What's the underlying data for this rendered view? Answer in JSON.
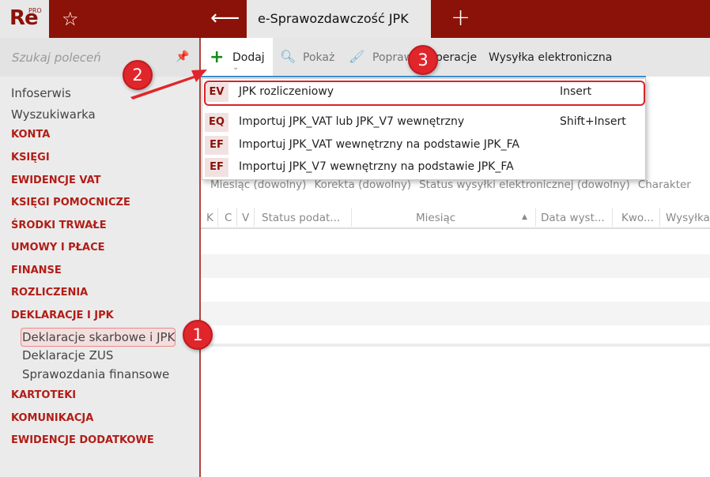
{
  "app": {
    "logo": "Re",
    "logo_sup": "PRO",
    "tab_title": "e-Sprawozdawczość JPK"
  },
  "sidebar": {
    "search_placeholder": "Szukaj poleceń",
    "items": [
      {
        "label": "Infoserwis",
        "type": "plain"
      },
      {
        "label": "Wyszukiwarka",
        "type": "plain"
      },
      {
        "label": "KONTA",
        "type": "sect"
      },
      {
        "label": "KSIĘGI",
        "type": "sect"
      },
      {
        "label": "EWIDENCJE VAT",
        "type": "sect"
      },
      {
        "label": "KSIĘGI POMOCNICZE",
        "type": "sect"
      },
      {
        "label": "ŚRODKI TRWAŁE",
        "type": "sect"
      },
      {
        "label": "UMOWY I PŁACE",
        "type": "sect"
      },
      {
        "label": "FINANSE",
        "type": "sect"
      },
      {
        "label": "ROZLICZENIA",
        "type": "sect"
      },
      {
        "label": "DEKLARACJE I JPK",
        "type": "sect"
      },
      {
        "label": "Deklaracje skarbowe i JPK",
        "type": "sub"
      },
      {
        "label": "Deklaracje ZUS",
        "type": "sub"
      },
      {
        "label": "Sprawozdania finansowe",
        "type": "sub"
      },
      {
        "label": "KARTOTEKI",
        "type": "sect"
      },
      {
        "label": "KOMUNIKACJA",
        "type": "sect"
      },
      {
        "label": "EWIDENCJE DODATKOWE",
        "type": "sect"
      }
    ]
  },
  "toolbar": {
    "add": "Dodaj",
    "show": "Pokaż",
    "edit": "Popraw",
    "operations": "Operacje",
    "send": "Wysyłka elektroniczna"
  },
  "menu": [
    {
      "badge": "EV",
      "label": "JPK rozliczeniowy",
      "shortcut": "Insert"
    },
    {
      "badge": "EQ",
      "label": "Importuj JPK_VAT lub JPK_V7 wewnętrzny",
      "shortcut": "Shift+Insert"
    },
    {
      "badge": "EF",
      "label": "Importuj JPK_VAT wewnętrzny na podstawie JPK_FA",
      "shortcut": ""
    },
    {
      "badge": "EF",
      "label": "Importuj JPK_V7 wewnętrzny na podstawie JPK_FA",
      "shortcut": ""
    }
  ],
  "filters": [
    "Miesiąc (dowolny)",
    "Korekta (dowolny)",
    "Status wysyłki elektronicznej (dowolny)",
    "Charakter"
  ],
  "columns": [
    "K",
    "C",
    "V",
    "Status podat...",
    "Miesiąc",
    "Data wyst...",
    "Kwo...",
    "Wysyłka"
  ],
  "callouts": [
    "1",
    "2",
    "3"
  ],
  "colors": {
    "brand": "#8b1208",
    "section": "#b21d17",
    "callout": "#e0262b"
  }
}
